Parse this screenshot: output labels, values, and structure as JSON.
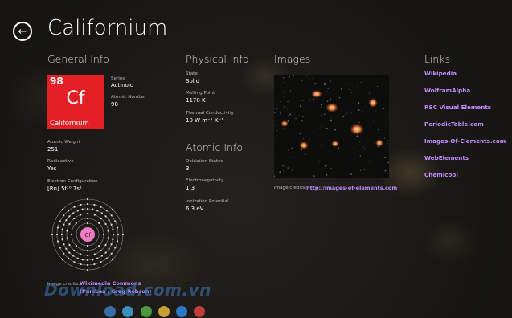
{
  "header": {
    "title": "Californium"
  },
  "general": {
    "heading": "General Info",
    "tile": {
      "number": "98",
      "symbol": "Cf",
      "name": "Californium"
    },
    "series_label": "Series",
    "series_value": "Actinoid",
    "atomic_number_label": "Atomic Number",
    "atomic_number_value": "98",
    "atomic_weight_label": "Atomic Weight",
    "atomic_weight_value": "251",
    "radioactive_label": "Radioactive",
    "radioactive_value": "Yes",
    "electron_config_label": "Electron Configuration",
    "electron_config_value": "[Rn] 5f¹⁰ 7s²",
    "bohr_symbol": "Cf",
    "credit_label": "Image credits:",
    "credit_link1": "Wikimedia Commons",
    "credit_link2": "(Pumbaa / Greg Robson)"
  },
  "physical": {
    "heading": "Physical Info",
    "state_label": "State",
    "state_value": "Solid",
    "melting_label": "Melting Point",
    "melting_value": "1170 K",
    "thermal_label": "Thermal Conductivity",
    "thermal_value": "10 W·m⁻¹·K⁻¹"
  },
  "atomic": {
    "heading": "Atomic Info",
    "oxidation_label": "Oxidation States",
    "oxidation_value": "3",
    "electroneg_label": "Electronegativity",
    "electroneg_value": "1.3",
    "ionization_label": "Ionization Potential",
    "ionization_value": "6.3 eV"
  },
  "images": {
    "heading": "Images",
    "credit_label": "Image credits:",
    "credit_link": "http://images-of-elements.com"
  },
  "links": {
    "heading": "Links",
    "items": [
      "Wikipedia",
      "WolframAlpha",
      "RSC Visual Elements",
      "PeriodicTable.com",
      "Images-Of-Elements.com",
      "WebElements",
      "Chemicool"
    ]
  },
  "watermark": "Download.com.vn",
  "colors": {
    "tile": "#e32026",
    "link": "#c38cff",
    "dots": [
      "#3a6ea8",
      "#3a8fbf",
      "#4c9a3e",
      "#c8a030",
      "#2c78c4",
      "#c23a3a"
    ]
  }
}
